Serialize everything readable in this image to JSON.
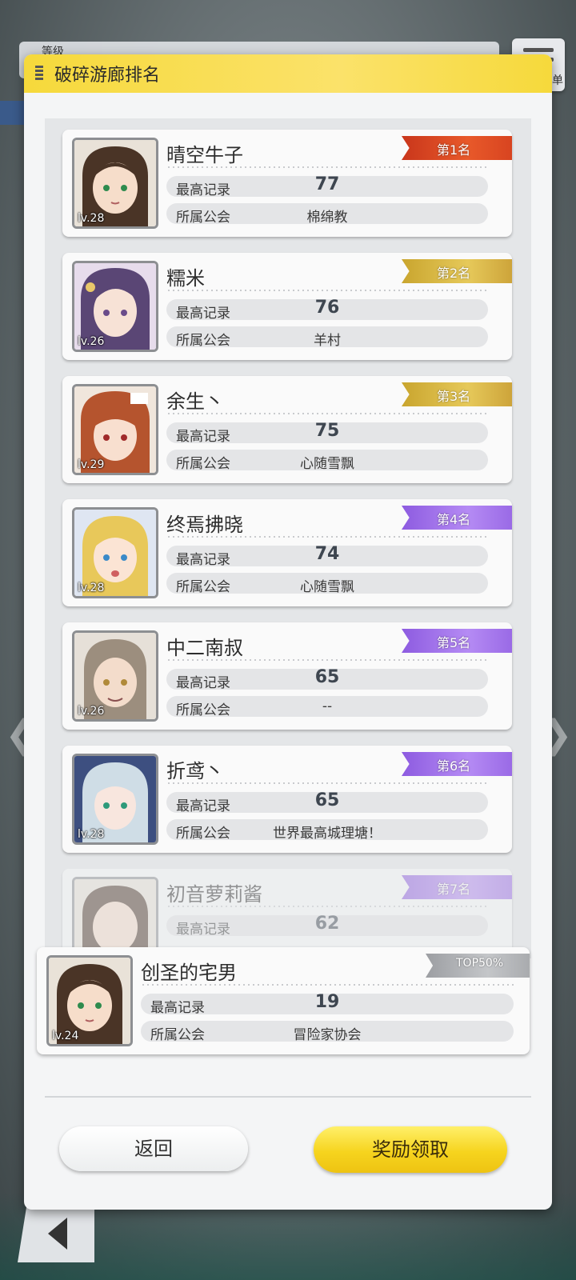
{
  "background": {
    "level_label": "等级",
    "menu_label": "单"
  },
  "dialog": {
    "title": "破碎游廊排名",
    "stat_labels": {
      "record": "最高记录",
      "guild": "所属公会"
    },
    "entries": [
      {
        "rank_label": "第1名",
        "name": "晴空牛子",
        "level": "lv.28",
        "record": "77",
        "guild": "棉绵教"
      },
      {
        "rank_label": "第2名",
        "name": "糯米",
        "level": "lv.26",
        "record": "76",
        "guild": "羊村"
      },
      {
        "rank_label": "第3名",
        "name": "余生丶",
        "level": "lv.29",
        "record": "75",
        "guild": "心随雪飘"
      },
      {
        "rank_label": "第4名",
        "name": "终焉拂晓",
        "level": "lv.28",
        "record": "74",
        "guild": "心随雪飘"
      },
      {
        "rank_label": "第5名",
        "name": "中二南叔",
        "level": "lv.26",
        "record": "65",
        "guild": "--"
      },
      {
        "rank_label": "第6名",
        "name": "折鸢丶",
        "level": "lv.28",
        "record": "65",
        "guild": "世界最高城理塘！"
      },
      {
        "rank_label": "第7名",
        "name": "初音萝莉酱",
        "level": "",
        "record": "62",
        "guild": ""
      }
    ],
    "my_entry": {
      "rank_label": "TOP50%",
      "name": "创圣的宅男",
      "level": "lv.24",
      "record": "19",
      "guild": "冒险家协会"
    },
    "buttons": {
      "back": "返回",
      "claim": "奖励领取"
    }
  },
  "colors": {
    "header": "#f6d93b",
    "rank_gold": "#d2ad3c",
    "rank_red": "#d8441f",
    "rank_purple": "#a277ea",
    "rank_gray": "#a9abae",
    "claim_button": "#f6d41e"
  }
}
